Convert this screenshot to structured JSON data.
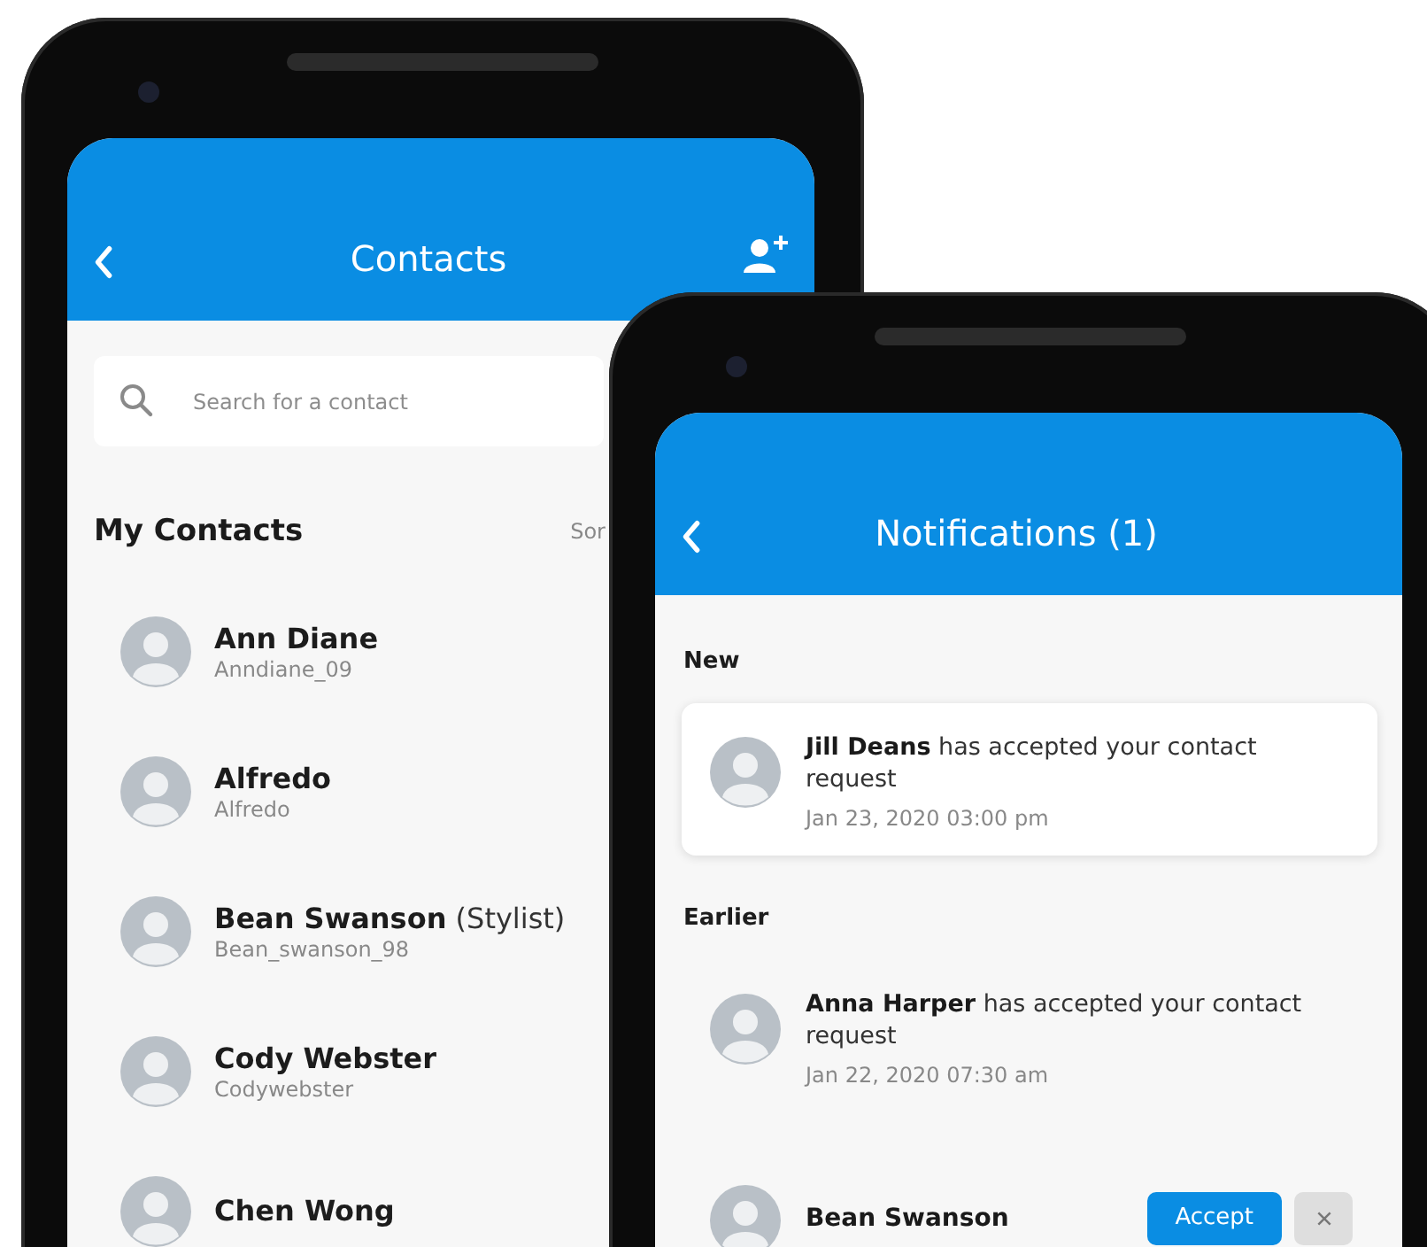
{
  "contacts_screen": {
    "header": {
      "title": "Contacts"
    },
    "search": {
      "placeholder": "Search for a contact"
    },
    "section": {
      "title": "My Contacts",
      "sort_label": "Sor"
    },
    "contacts": [
      {
        "name": "Ann Diane",
        "username": "Anndiane_09"
      },
      {
        "name": "Alfredo",
        "username": "Alfredo"
      },
      {
        "name": "Bean Swanson",
        "note": "(Stylist)",
        "username": "Bean_swanson_98"
      },
      {
        "name": "Cody Webster",
        "username": "Codywebster"
      },
      {
        "name": "Chen Wong"
      }
    ]
  },
  "notifications_screen": {
    "header": {
      "title": "Notifications (1)"
    },
    "sections": [
      {
        "title": "New",
        "items": [
          {
            "kind": "accepted",
            "unread": true,
            "text": "**Jill Deans** has accepted your contact request",
            "time": "Jan 23, 2020 03:00 pm"
          }
        ]
      },
      {
        "title": "Earlier",
        "items": [
          {
            "kind": "accepted",
            "unread": false,
            "text": "**Anna Harper** has accepted your contact request",
            "time": "Jan 22, 2020 07:30 am"
          },
          {
            "kind": "request",
            "unread": false,
            "name": "Bean Swanson",
            "accept_label": "Accept"
          }
        ]
      }
    ]
  }
}
